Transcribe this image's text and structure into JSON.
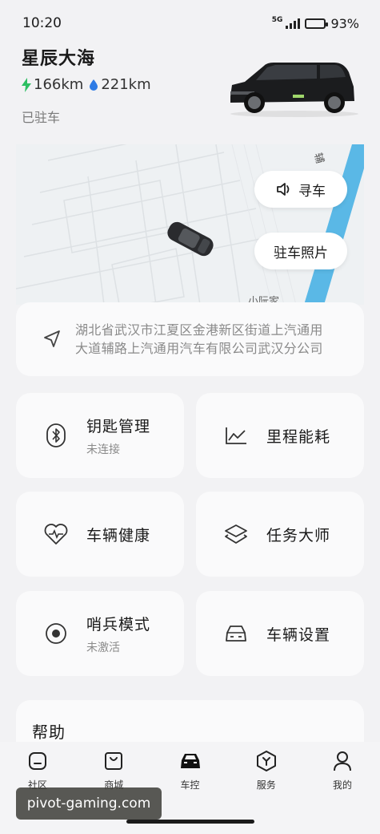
{
  "status_bar": {
    "time": "10:20",
    "network": "5G",
    "battery": "93%",
    "battery_level": 0.93
  },
  "vehicle": {
    "name": "星辰大海",
    "electric_range": "166km",
    "fuel_range": "221km",
    "park_status": "已驻车",
    "colors": {
      "electric": "#2dbf62",
      "fuel": "#2d7be5"
    }
  },
  "map": {
    "find_car_label": "寻车",
    "parking_photo_label": "驻车照片",
    "street_label_1": "辅",
    "street_label_2": "小阮家"
  },
  "address": {
    "line1": "湖北省武汉市江夏区金港新区街道上汽通用",
    "line2": "大道辅路上汽通用汽车有限公司武汉分公司"
  },
  "tiles": [
    {
      "title": "钥匙管理",
      "subtitle": "未连接",
      "icon": "bluetooth-icon"
    },
    {
      "title": "里程能耗",
      "subtitle": "",
      "icon": "chart-line-icon"
    },
    {
      "title": "车辆健康",
      "subtitle": "",
      "icon": "heart-pulse-icon"
    },
    {
      "title": "任务大师",
      "subtitle": "",
      "icon": "layers-icon"
    },
    {
      "title": "哨兵模式",
      "subtitle": "未激活",
      "icon": "sentry-icon"
    },
    {
      "title": "车辆设置",
      "subtitle": "",
      "icon": "car-front-icon"
    }
  ],
  "help": {
    "title": "帮助"
  },
  "tabbar": {
    "items": [
      {
        "label": "社区",
        "icon": "community-icon"
      },
      {
        "label": "商城",
        "icon": "shop-bag-icon"
      },
      {
        "label": "车控",
        "icon": "car-control-icon",
        "active": true
      },
      {
        "label": "服务",
        "icon": "service-icon"
      },
      {
        "label": "我的",
        "icon": "profile-icon"
      }
    ]
  },
  "watermark": "pivot-gaming.com"
}
